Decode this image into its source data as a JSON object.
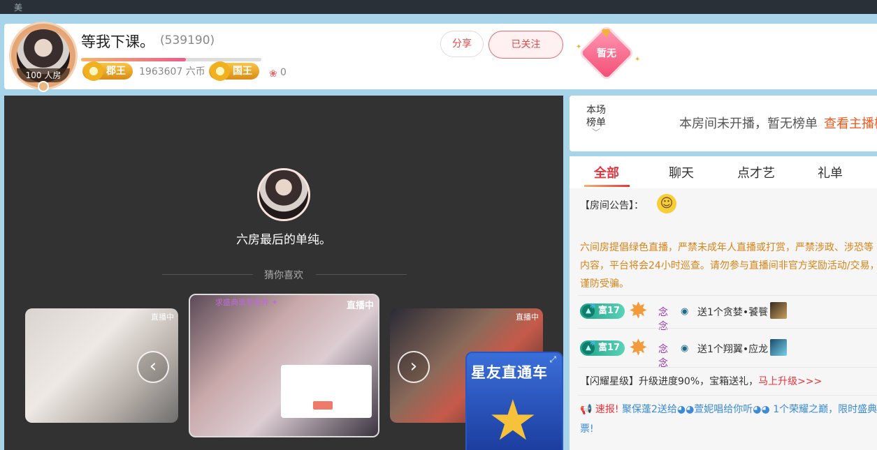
{
  "topbar": {
    "ghost_text": "美"
  },
  "header": {
    "avatar_caption": "100 人房",
    "anchor_name": "等我下课。",
    "room_id": "(539190)",
    "level_progress": 0.58,
    "badge_1": "郡王",
    "coins": "1963607 六币",
    "badge_2": "国王",
    "fans_count": "0",
    "share_label": "分享",
    "follow_label": "已关注",
    "heart_badge_text": "暂无"
  },
  "player": {
    "streamer_name": "六房最后的单纯。",
    "guess_label": "猜你喜欢",
    "cards": [
      {
        "live_tag": "直播中"
      },
      {
        "live_tag": "直播中",
        "banner": "求盛典票票各种 ✦"
      },
      {
        "live_tag": "直播中"
      }
    ],
    "prev_icon": "‹",
    "next_icon": "›",
    "promo_text": "星友直通车"
  },
  "rank": {
    "label": "本场\n榜单",
    "message": "本房间未开播，暂无榜单",
    "link": "查看主播榜"
  },
  "chat": {
    "tabs": [
      "全部",
      "聊天",
      "点才艺",
      "礼单"
    ],
    "notice_title": "【房间公告】：",
    "notice_text": "六间房提倡绿色直播，严禁未成年人直播或打赏，严禁涉政、涉恐等内容，平台将会24小时巡查。请勿参与直播间非官方奖励活动/交易，谨防受骗。",
    "gift_rows": [
      {
        "rich_level": "富17",
        "rank_num": "1",
        "user": "念念",
        "text": "送1个贪婪•饕餮"
      },
      {
        "rich_level": "富17",
        "rank_num": "1",
        "user": "念念",
        "text": "送1个翔翼•应龙"
      }
    ],
    "star_level_text": "【闪耀星级】升级进度90%，宝箱送礼，",
    "star_level_link": "马上升级>>>",
    "news_label": "速报!",
    "news_text": "聚保蓬2送给◕◕萱妮唱给你听◕◕ 1个荣耀之巅，限时盛典票!"
  },
  "colors": {
    "accent_red": "#e8343c",
    "notice_orange": "#d98318",
    "link_orange": "#f05a20",
    "page_bg": "#a8d4ea"
  }
}
